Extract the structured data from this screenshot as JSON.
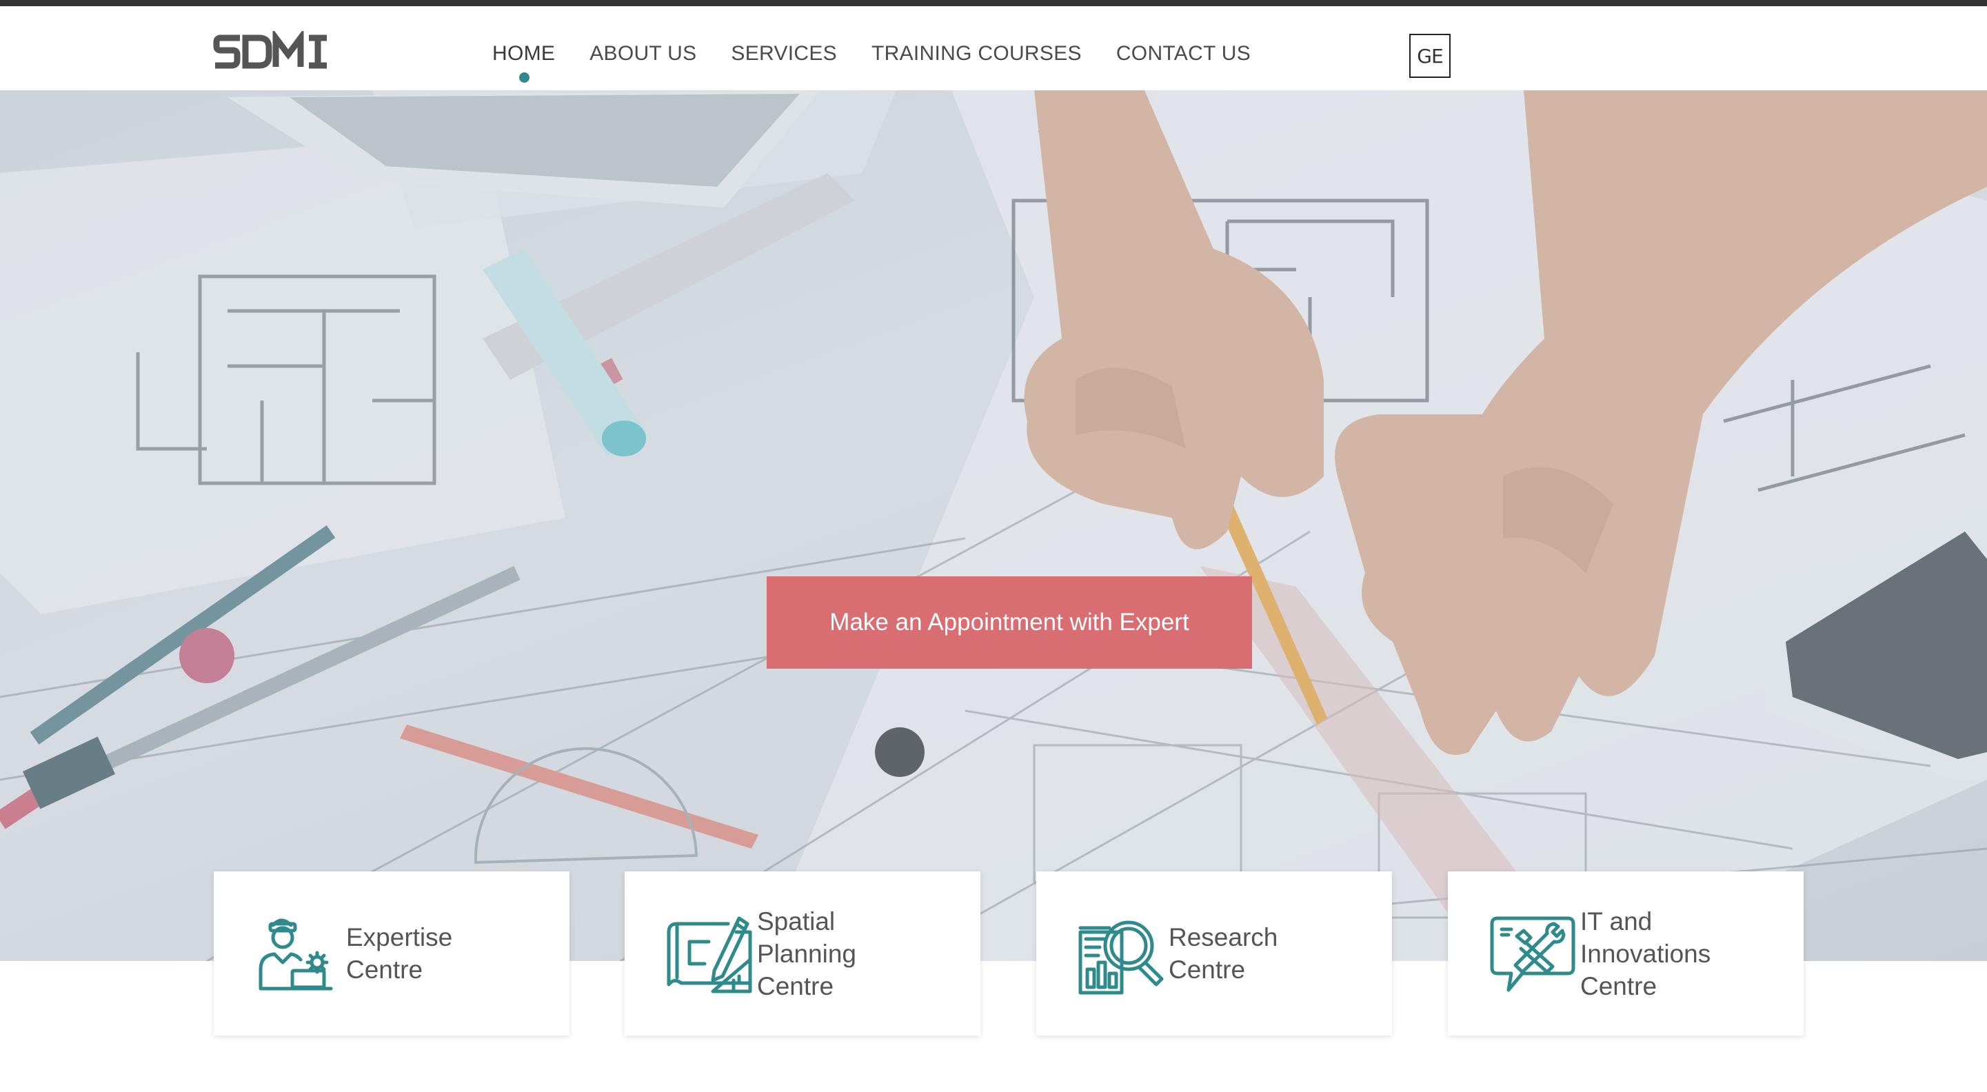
{
  "header": {
    "logo_text": "SDMI",
    "nav": [
      {
        "label": "HOME",
        "active": true
      },
      {
        "label": "ABOUT US",
        "active": false
      },
      {
        "label": "SERVICES",
        "active": false
      },
      {
        "label": "TRAINING COURSES",
        "active": false
      },
      {
        "label": "CONTACT US",
        "active": false
      }
    ],
    "lang_button": "GE"
  },
  "hero": {
    "cta_label": "Make an Appointment with Expert"
  },
  "cards": [
    {
      "label_lines": [
        "Expertise",
        "Centre"
      ],
      "icon": "expert-icon"
    },
    {
      "label_lines": [
        "Spatial",
        "Planning",
        "Centre"
      ],
      "icon": "blueprint-icon"
    },
    {
      "label_lines": [
        "Research",
        "Centre"
      ],
      "icon": "research-icon"
    },
    {
      "label_lines": [
        "IT and",
        "Innovations",
        "Centre"
      ],
      "icon": "tools-chat-icon"
    }
  ],
  "colors": {
    "accent_teal": "#2f8a8c",
    "cta_red": "#d96e72",
    "text_gray": "#555555"
  }
}
